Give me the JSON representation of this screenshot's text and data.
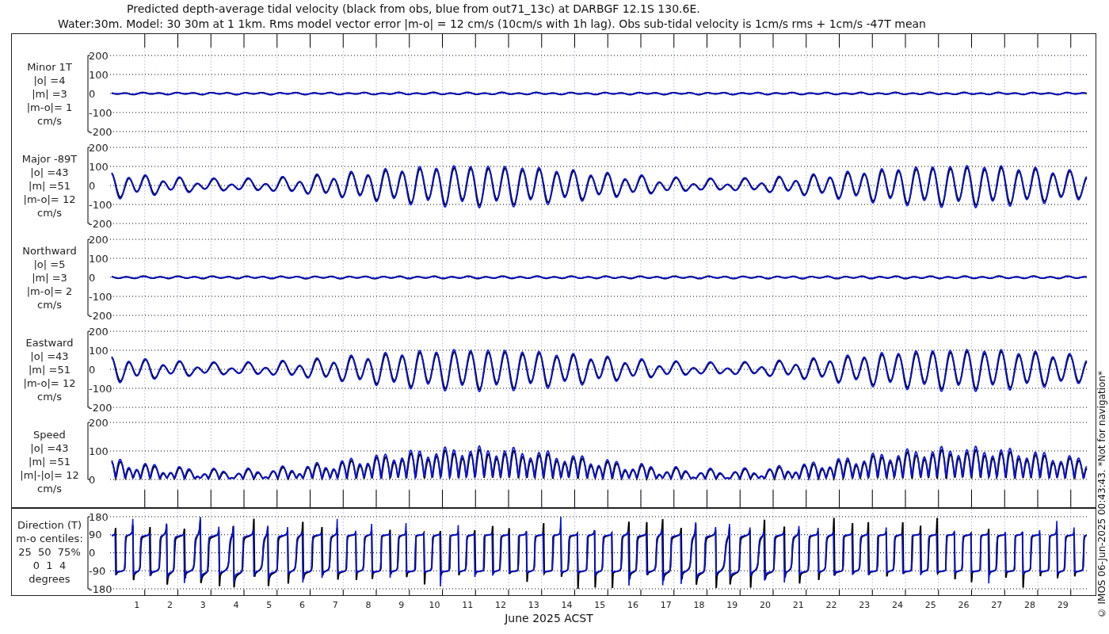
{
  "title": {
    "line_1": "Predicted depth-average tidal velocity (black from obs, blue from out71_13c) at DARBGF 12.1S 130.6E.",
    "line_2": "Water:30m. Model: 30 30m at 1 1km. Rms model vector error |m-o| = 12 cm/s (10cm/s with 1h lag). Obs sub-tidal velocity is 1cm/s rms + 1cm/s -47T mean"
  },
  "panels": [
    {
      "kind": "minor",
      "label_lines": [
        "Minor 1T",
        "|o| =4",
        "|m| =3",
        "|m-o|= 1",
        "cm/s"
      ],
      "yticks": [
        "200",
        "100",
        "0",
        "-100",
        "-200"
      ]
    },
    {
      "kind": "major",
      "label_lines": [
        "Major -89T",
        "|o| =43",
        "|m| =51",
        "|m-o|= 12",
        "cm/s"
      ],
      "yticks": [
        "200",
        "100",
        "0",
        "-100",
        "-200"
      ]
    },
    {
      "kind": "northward",
      "label_lines": [
        "Northward",
        "|o| =5",
        "|m| =3",
        "|m-o|= 2",
        "cm/s"
      ],
      "yticks": [
        "200",
        "100",
        "0",
        "-100",
        "-200"
      ]
    },
    {
      "kind": "eastward",
      "label_lines": [
        "Eastward",
        "|o| =43",
        "|m| =51",
        "|m-o|= 12",
        "cm/s"
      ],
      "yticks": [
        "200",
        "100",
        "0",
        "-100",
        "-200"
      ]
    },
    {
      "kind": "speed",
      "label_lines": [
        "Speed",
        "|o| =43",
        "|m| =51",
        "|m|-|o|= 12",
        "cm/s"
      ],
      "yticks": [
        "200",
        "100",
        "0"
      ]
    }
  ],
  "direction_panel": {
    "kind": "direction",
    "label_lines": [
      "Direction (T)",
      "m-o centiles:",
      "25  50  75%",
      "0  1  4",
      "degrees"
    ],
    "yticks": [
      "180",
      "90",
      "0",
      "-90",
      "-180"
    ]
  },
  "x_axis": {
    "ticks": [
      "1",
      "2",
      "3",
      "4",
      "5",
      "6",
      "7",
      "8",
      "9",
      "10",
      "11",
      "12",
      "13",
      "14",
      "15",
      "16",
      "17",
      "18",
      "19",
      "20",
      "21",
      "22",
      "23",
      "24",
      "25",
      "26",
      "27",
      "28",
      "29"
    ],
    "label": "June 2025 ACST"
  },
  "footer": "© IMOS 06-Jun-2025 00:43:43. *Not for navigation*"
}
